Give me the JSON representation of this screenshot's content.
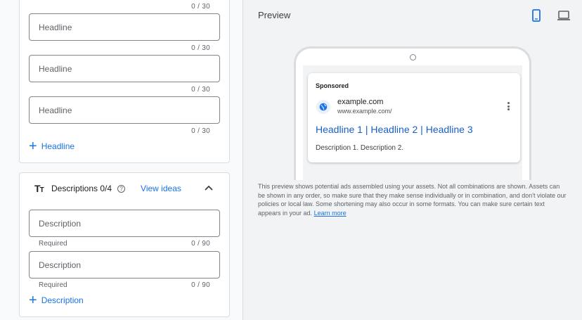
{
  "headlines": {
    "top_counter": "0 / 30",
    "fields": [
      {
        "placeholder": "Headline",
        "counter": "0 / 30"
      },
      {
        "placeholder": "Headline",
        "counter": "0 / 30"
      },
      {
        "placeholder": "Headline",
        "counter": "0 / 30"
      }
    ],
    "add_label": "Headline"
  },
  "descriptions": {
    "title": "Descriptions 0/4",
    "icon_glyph": "TT",
    "view_ideas": "View ideas",
    "fields": [
      {
        "placeholder": "Description",
        "helper": "Required",
        "counter": "0 / 90"
      },
      {
        "placeholder": "Description",
        "helper": "Required",
        "counter": "0 / 90"
      }
    ],
    "add_label": "Description"
  },
  "preview": {
    "title": "Preview",
    "devices": [
      "mobile-icon",
      "desktop-icon"
    ],
    "selected_device": "mobile",
    "ad": {
      "sponsored": "Sponsored",
      "site_name": "example.com",
      "site_url": "www.example.com/",
      "headline": "Headline 1 | Headline 2 | Headline 3",
      "description": "Description 1. Description 2."
    },
    "disclaimer": "This preview shows potential ads assembled using your assets. Not all combinations are shown. Assets can be shown in any order, so make sure that they make sense individually or in combination, and don't violate our policies or local law. Some shortening may also occur in some formats. You can make sure certain text appears in your ad.",
    "learn_more": "Learn more"
  },
  "colors": {
    "accent": "#1a73e8",
    "headline_link": "#1a5fc4",
    "border": "#dadce0"
  }
}
